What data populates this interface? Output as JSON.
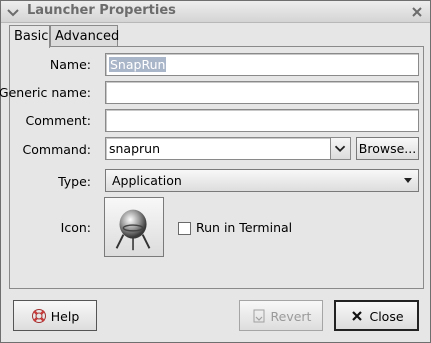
{
  "window": {
    "title": "Launcher Properties"
  },
  "tabs": [
    {
      "label": "Basic",
      "active": true
    },
    {
      "label": "Advanced",
      "active": false
    }
  ],
  "form": {
    "name": {
      "label": "Name:",
      "value": "SnapRun"
    },
    "generic_name": {
      "label": "Generic name:",
      "value": ""
    },
    "comment": {
      "label": "Comment:",
      "value": ""
    },
    "command": {
      "label": "Command:",
      "value": "snaprun",
      "browse_label": "Browse..."
    },
    "type": {
      "label": "Type:",
      "value": "Application"
    },
    "icon": {
      "label": "Icon:",
      "name": "launcher-app-icon"
    },
    "run_in_terminal": {
      "label": "Run in Terminal",
      "checked": false
    }
  },
  "buttons": {
    "help": "Help",
    "revert": "Revert",
    "close": "Close"
  },
  "colors": {
    "selection": "#a9b5c8",
    "window_bg": "#e6e6e6"
  }
}
